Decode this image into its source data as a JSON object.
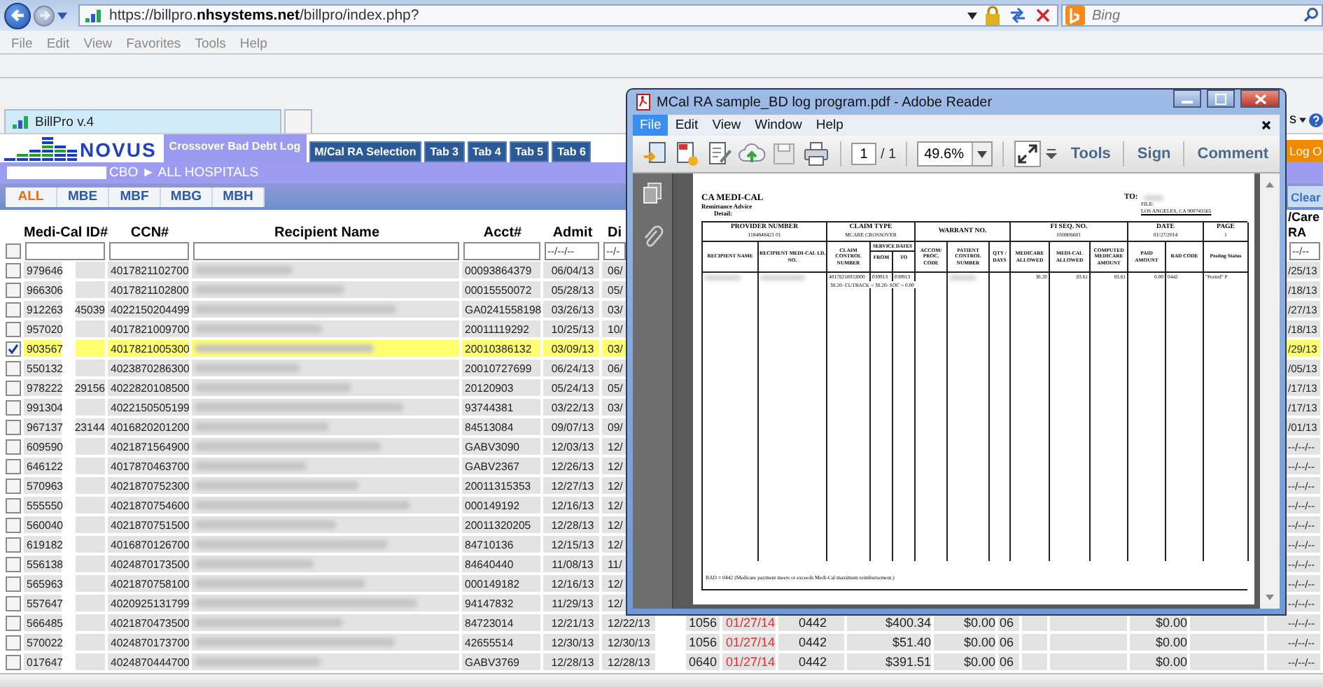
{
  "browser": {
    "url": "https://billpro.**nhsystems.net**/billpro/index.php?",
    "search_placeholder": "Bing",
    "menu": [
      "File",
      "Edit",
      "View",
      "Favorites",
      "Tools",
      "Help"
    ],
    "tabs": [
      {
        "label": "BillPro v.4",
        "selected": true
      }
    ],
    "command_fragment": "s"
  },
  "app": {
    "logo": "NOVUS",
    "tabs": [
      {
        "label": "Crossover Bad Debt Log",
        "selected": true
      },
      {
        "label": "M/Cal RA Selection",
        "selected": false
      },
      {
        "label": "Tab 3",
        "selected": false
      },
      {
        "label": "Tab 4",
        "selected": false
      },
      {
        "label": "Tab 5",
        "selected": false
      },
      {
        "label": "Tab 6",
        "selected": false
      }
    ],
    "logout": "Log O",
    "breadcrumb": "CBO ► ALL HOSPITALS",
    "hospitals": [
      {
        "label": "ALL",
        "selected": true
      },
      {
        "label": "MBE",
        "selected": false
      },
      {
        "label": "MBF",
        "selected": false
      },
      {
        "label": "MBG",
        "selected": false
      },
      {
        "label": "MBH",
        "selected": false
      }
    ],
    "clear": "Clear"
  },
  "table": {
    "columns": [
      "Medi-Cal ID#",
      "CCN#",
      "Recipient Name",
      "Acct#",
      "Admit",
      "Di"
    ],
    "last_column": "/Care RA",
    "select_all_checked": false,
    "date_filters": [
      {
        "placeholder": "--/--/--"
      },
      {
        "placeholder": "--/-"
      },
      {
        "placeholder": "--/--"
      }
    ],
    "rows": [
      {
        "medi_cal_id": "979646",
        "ccn": "4017821102700",
        "acct": "00093864379",
        "admit": "06/04/13",
        "discharge": "06/",
        "care_ra": "/25/13",
        "checked": false
      },
      {
        "medi_cal_id": "966306",
        "ccn": "4017821102800",
        "acct": "00015550072",
        "admit": "05/28/13",
        "discharge": "05/",
        "care_ra": "/18/13",
        "checked": false
      },
      {
        "medi_cal_id": "912263",
        "id_suffix": "45039",
        "ccn": "4022150204499",
        "acct": "GA0241558198",
        "admit": "03/26/13",
        "discharge": "03/",
        "care_ra": "/27/13",
        "checked": false
      },
      {
        "medi_cal_id": "957020",
        "ccn": "4017821009700",
        "acct": "20011119292",
        "admit": "10/25/13",
        "discharge": "10/",
        "care_ra": "/18/13",
        "checked": false
      },
      {
        "medi_cal_id": "903567",
        "ccn": "4017821005300",
        "acct": "20010386132",
        "admit": "03/09/13",
        "discharge": "03/",
        "care_ra": "/29/13",
        "checked": true
      },
      {
        "medi_cal_id": "550132",
        "ccn": "4023870286300",
        "acct": "20010727699",
        "admit": "06/24/13",
        "discharge": "06/",
        "care_ra": "/05/13",
        "checked": false
      },
      {
        "medi_cal_id": "978222",
        "id_suffix": "29156",
        "ccn": "4022820108500",
        "acct": "20120903",
        "admit": "05/24/13",
        "discharge": "05/",
        "care_ra": "/17/13",
        "checked": false
      },
      {
        "medi_cal_id": "991304",
        "ccn": "4022150505199",
        "acct": "93744381",
        "admit": "03/22/13",
        "discharge": "03/",
        "care_ra": "/17/13",
        "checked": false
      },
      {
        "medi_cal_id": "967137",
        "id_suffix": "23144",
        "ccn": "4016820201200",
        "acct": "84513084",
        "admit": "09/07/13",
        "discharge": "09/",
        "care_ra": "/01/13",
        "checked": false
      },
      {
        "medi_cal_id": "609590",
        "ccn": "4021871564900",
        "acct": "GABV3090",
        "admit": "12/03/13",
        "discharge": "12/",
        "care_ra": "--/--/--",
        "checked": false
      },
      {
        "medi_cal_id": "646122",
        "ccn": "4017870463700",
        "acct": "GABV2367",
        "admit": "12/26/13",
        "discharge": "12/",
        "care_ra": "--/--/--",
        "checked": false
      },
      {
        "medi_cal_id": "570963",
        "ccn": "4021870752300",
        "acct": "20011315353",
        "admit": "12/27/13",
        "discharge": "12/",
        "care_ra": "--/--/--",
        "checked": false
      },
      {
        "medi_cal_id": "555550",
        "ccn": "4021870754600",
        "acct": "000149192",
        "admit": "12/16/13",
        "discharge": "12/",
        "care_ra": "--/--/--",
        "checked": false
      },
      {
        "medi_cal_id": "560040",
        "ccn": "4021870751500",
        "acct": "20011320205",
        "admit": "12/28/13",
        "discharge": "12/",
        "care_ra": "--/--/--",
        "checked": false
      },
      {
        "medi_cal_id": "619182",
        "ccn": "4016870126700",
        "acct": "84710136",
        "admit": "12/15/13",
        "discharge": "12/",
        "care_ra": "--/--/--",
        "checked": false
      },
      {
        "medi_cal_id": "556138",
        "ccn": "4024870173500",
        "acct": "84640440",
        "admit": "11/08/13",
        "discharge": "11/",
        "care_ra": "--/--/--",
        "checked": false
      },
      {
        "medi_cal_id": "565963",
        "ccn": "4021870758100",
        "acct": "000149182",
        "admit": "12/16/13",
        "discharge": "12/",
        "care_ra": "--/--/--",
        "checked": false
      },
      {
        "medi_cal_id": "557647",
        "ccn": "4020925131799",
        "acct": "94147832",
        "admit": "11/29/13",
        "discharge": "12/",
        "care_ra": "--/--/--",
        "checked": false
      },
      {
        "medi_cal_id": "566485",
        "ccn": "4021870473500",
        "acct": "84723014",
        "admit": "12/21/13",
        "discharge": "12/22/13",
        "column_8": "1056",
        "column_9": "01/27/14",
        "column_10": "0442",
        "column_11": "$400.34",
        "column_12": "$0.00",
        "column_13": "06",
        "column_16": "$0.00",
        "care_ra": "--/--/--",
        "checked": false
      },
      {
        "medi_cal_id": "570022",
        "ccn": "4024870173700",
        "acct": "42655514",
        "admit": "12/30/13",
        "discharge": "12/30/13",
        "column_8": "1056",
        "column_9": "01/27/14",
        "column_10": "0442",
        "column_11": "$51.40",
        "column_12": "$0.00",
        "column_13": "06",
        "column_16": "$0.00",
        "care_ra": "--/--/--",
        "checked": false
      },
      {
        "medi_cal_id": "017647",
        "ccn": "4024870444700",
        "acct": "GABV3769",
        "admit": "12/28/13",
        "discharge": "12/28/13",
        "column_8": "0640",
        "column_9": "01/27/14",
        "column_10": "0442",
        "column_11": "$391.51",
        "column_12": "$0.00",
        "column_13": "06",
        "column_16": "$0.00",
        "care_ra": "--/--/--",
        "checked": false
      }
    ]
  },
  "reader": {
    "title": "MCal RA sample_BD log program.pdf - Adobe Reader",
    "menu": [
      {
        "label": "File",
        "selected": true
      },
      {
        "label": "Edit",
        "selected": false
      },
      {
        "label": "View",
        "selected": false
      },
      {
        "label": "Window",
        "selected": false
      },
      {
        "label": "Help",
        "selected": false
      }
    ],
    "page": "1",
    "page_total": "/ 1",
    "zoom": "49.6%",
    "tools": [
      "Tools",
      "Sign",
      "Comment"
    ],
    "document": {
      "heading": "CA MEDI-CAL",
      "subheading": "Remittance Advice",
      "section": "Detail:",
      "to_label": "TO:",
      "file_label": "FILE:",
      "address": "LOS ANGELES, CA 900741565",
      "summary": [
        {
          "label": "PROVIDER NUMBER",
          "value": "1184848421   01"
        },
        {
          "label": "CLAIM TYPE",
          "value": "MCARE CROSSOVER"
        },
        {
          "label": "WARRANT NO."
        },
        {
          "label": "FI SEQ. NO.",
          "value": "050806601"
        },
        {
          "label": "DATE",
          "value": "01/27/2014"
        },
        {
          "label": "PAGE",
          "value": "1"
        }
      ],
      "service_dates_label": "SERVICE DATES",
      "columns": [
        "RECIPIENT NAME",
        "RECIPIENT MEDI-CAL I.D. NO.",
        "CLAIM CONTROL NUMBER",
        "FROM",
        "TO",
        "ACCOM/ PROC. CODE",
        "PATIENT CONTROL NUMBER",
        "QTY / DAYS",
        "MEDICARE ALLOWED",
        "MEDI-CAL ALLOWED",
        "COMPUTED MEDICARE AMOUNT",
        "PAID AMOUNT",
        "RAD CODE",
        "Posting Status"
      ],
      "line": [
        {
          "kind": "blurred"
        },
        {
          "kind": "blurred"
        },
        {
          "kind": "text",
          "text": "40178210053000"
        },
        {
          "kind": "text",
          "text": "030913"
        },
        {
          "kind": "text",
          "text": "030913"
        },
        {
          "kind": "empty"
        },
        {
          "kind": "blurred"
        },
        {
          "kind": "empty"
        },
        {
          "kind": "text",
          "text": "38.20"
        },
        {
          "kind": "text",
          "text": "83.61"
        },
        {
          "kind": "text",
          "text": "83.61"
        },
        {
          "kind": "text",
          "text": "0.00"
        },
        {
          "kind": "text",
          "text": "0442"
        },
        {
          "kind": "text",
          "text": "\"Posted\"   P"
        }
      ],
      "cutback": "38.20-  CUTBACK = 38.20-  SOC = 0.00",
      "footnote": "RAD = 0442 (Medicare payment meets or exceeds Medi-Cal maximum reimbursement.)"
    }
  }
}
